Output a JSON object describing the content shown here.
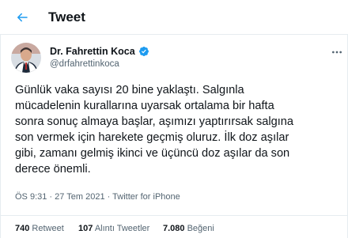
{
  "header": {
    "title": "Tweet",
    "back_icon": "arrow-left-icon",
    "accent_color": "#1d9bf0"
  },
  "author": {
    "display_name": "Dr. Fahrettin Koca",
    "handle": "@drfahrettinkoca",
    "verified": true,
    "verified_color": "#1d9bf0"
  },
  "tweet": {
    "text_lines": [
      "Günlük vaka sayısı 20 bine yaklaştı. Salgınla",
      "mücadelenin kurallarına uyarsak ortalama bir hafta",
      "sonra sonuç almaya başlar, aşımızı yaptırırsak salgına",
      "son vermek için harekete geçmiş oluruz. İlk doz aşılar",
      "gibi, zamanı gelmiş ikinci ve üçüncü doz aşılar da son",
      "derece önemli."
    ],
    "time": "ÖS 9:31",
    "separator": "·",
    "date": "27 Tem 2021",
    "source": "Twitter for iPhone"
  },
  "stats": {
    "retweets_count": "740",
    "retweets_label": "Retweet",
    "quotes_count": "107",
    "quotes_label": "Alıntı Tweetler",
    "likes_count": "7.080",
    "likes_label": "Beğeni"
  }
}
